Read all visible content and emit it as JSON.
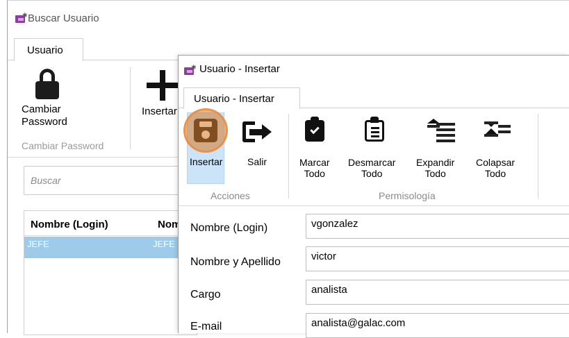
{
  "background_window": {
    "title": "Buscar Usuario",
    "tab": "Usuario",
    "ribbon": {
      "cambiar_password_label": "Cambiar\nPassword",
      "group_label": "Cambiar Password",
      "insertar_label": "Insertar"
    },
    "search": {
      "placeholder": "Buscar"
    },
    "table": {
      "columns": [
        "Nombre (Login)",
        "Nom"
      ],
      "rows": [
        [
          "JEFE",
          "JEFE"
        ]
      ]
    }
  },
  "dialog": {
    "title": "Usuario - Insertar",
    "tab": "Usuario - Insertar",
    "ribbon": {
      "acciones": {
        "group_label": "Acciones",
        "insertar_label": "Insertar",
        "salir_label": "Salir"
      },
      "permisologia": {
        "group_label": "Permisología",
        "marcar_todo_label": "Marcar\nTodo",
        "desmarcar_todo_label": "Desmarcar\nTodo",
        "expandir_todo_label": "Expandir\nTodo",
        "colapsar_todo_label": "Colapsar\nTodo"
      }
    },
    "form": {
      "nombre_login": {
        "label": "Nombre (Login)",
        "value": "vgonzalez"
      },
      "nombre_apellido": {
        "label": "Nombre y Apellido",
        "value": "victor"
      },
      "cargo": {
        "label": "Cargo",
        "value": "analista"
      },
      "email": {
        "label": "E-mail",
        "value": "analista@galac.com"
      }
    }
  },
  "colors": {
    "selection_row": "#9dcbe9",
    "active_button": "#cce4f7",
    "highlight": "#e07a30",
    "app_icon": "#8d3fa0"
  }
}
